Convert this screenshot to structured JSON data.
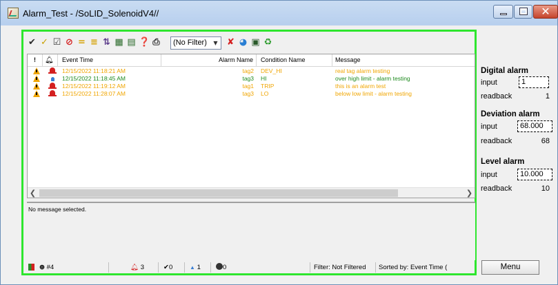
{
  "window": {
    "title": "Alarm_Test - /SoLID_SolenoidV4//"
  },
  "toolbar": {
    "buttons": [
      {
        "icon": "check-icon",
        "glyph": "✔",
        "color": "#2a2a2a"
      },
      {
        "icon": "ack-check-icon",
        "glyph": "✓",
        "color": "#c8a000"
      },
      {
        "icon": "ack-page-icon",
        "glyph": "☑",
        "color": "#444444"
      },
      {
        "icon": "disable-icon",
        "glyph": "⊘",
        "color": "#d42020"
      },
      {
        "icon": "shelve-icon",
        "glyph": "=",
        "color": "#d4a000"
      },
      {
        "icon": "unshelve-icon",
        "glyph": "≡",
        "color": "#d4a000"
      },
      {
        "icon": "sort-icon",
        "glyph": "⇅",
        "color": "#5a3a8a"
      },
      {
        "icon": "details-icon",
        "glyph": "▦",
        "color": "#2a6a2a"
      },
      {
        "icon": "trend-icon",
        "glyph": "▤",
        "color": "#2a6a2a"
      },
      {
        "icon": "help-icon",
        "glyph": "❓",
        "color": "#d4a000"
      },
      {
        "icon": "print-icon",
        "glyph": "⎙",
        "color": "#333333"
      }
    ],
    "filter": {
      "value": "(No Filter)"
    },
    "buttons_after": [
      {
        "icon": "clear-filter-icon",
        "glyph": "✘",
        "color": "#d42020"
      },
      {
        "icon": "globe-icon",
        "glyph": "◕",
        "color": "#2a7fd4"
      },
      {
        "icon": "properties-icon",
        "glyph": "▣",
        "color": "#2a5a2a"
      },
      {
        "icon": "refresh-icon",
        "glyph": "♻",
        "color": "#2a9a2a"
      }
    ]
  },
  "grid": {
    "headers": {
      "bang": "!",
      "bell": "",
      "event_time": "Event Time",
      "alarm_name": "Alarm Name",
      "condition_name": "Condition Name",
      "message": "Message"
    },
    "rows": [
      {
        "event_time": "12/15/2022 11:18:21 AM",
        "alarm_name": "tag2",
        "condition": "DEV_HI",
        "message": "real tag alarm testing",
        "color": "#f0a500",
        "bell": "red"
      },
      {
        "event_time": "12/15/2022 11:18:45 AM",
        "alarm_name": "tag3",
        "condition": "HI",
        "message": "over high limit - alarm testing",
        "color": "#1e8a1e",
        "bell": "blue"
      },
      {
        "event_time": "12/15/2022 11:19:12 AM",
        "alarm_name": "tag1",
        "condition": "TRIP",
        "message": "this is an alarm test",
        "color": "#f0a500",
        "bell": "red"
      },
      {
        "event_time": "12/15/2022 11:28:07 AM",
        "alarm_name": "tag3",
        "condition": "LO",
        "message": "below low limit - alarm testing",
        "color": "#f0a500",
        "bell": "red"
      }
    ]
  },
  "message_pane": {
    "text": "No message selected."
  },
  "statusbar": {
    "total": "#4",
    "red_count": "3",
    "ack_count": "0",
    "blue_count": "1",
    "dark_count": "0",
    "filter_text": "Filter: Not Filtered",
    "sort_text": "Sorted by: Event Time ("
  },
  "side_panel": {
    "digital": {
      "title": "Digital alarm",
      "input_label": "input",
      "input_value": "1",
      "readback_label": "readback",
      "readback_value": "1"
    },
    "deviation": {
      "title": "Deviation alarm",
      "input_label": "input",
      "input_value": "68.000",
      "readback_label": "readback",
      "readback_value": "68"
    },
    "level": {
      "title": "Level alarm",
      "input_label": "input",
      "input_value": "10.000",
      "readback_label": "readback",
      "readback_value": "10"
    },
    "menu_label": "Menu"
  },
  "colors": {
    "highlight_border": "#2ee62e",
    "alarm_red": "#d42020",
    "alarm_orange": "#f0a500",
    "alarm_green": "#1e8a1e"
  }
}
